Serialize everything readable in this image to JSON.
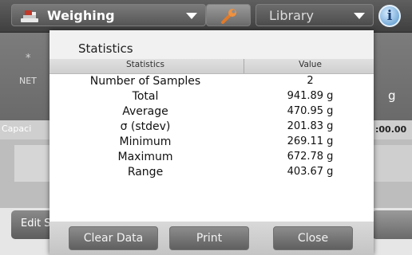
{
  "topbar": {
    "app_label": "Weighing",
    "library_label": "Library",
    "info_symbol": "i",
    "icons": {
      "app": "scale-icon",
      "tools": "wrench-icon",
      "info": "info-icon"
    }
  },
  "background": {
    "star": "*",
    "net_label": "NET",
    "unit": "g",
    "capacity_label": "Capaci",
    "capacity_value": ":00.00",
    "edit_label": "Edit S"
  },
  "dialog": {
    "title": "Statistics",
    "table": {
      "headers": {
        "statistic": "Statistics",
        "value": "Value"
      },
      "rows": [
        {
          "name": "Number of Samples",
          "value": "2"
        },
        {
          "name": "Total",
          "value": "941.89 g"
        },
        {
          "name": "Average",
          "value": "470.95 g"
        },
        {
          "name": "σ (stdev)",
          "value": "201.83 g"
        },
        {
          "name": "Minimum",
          "value": "269.11 g"
        },
        {
          "name": "Maximum",
          "value": "672.78 g"
        },
        {
          "name": "Range",
          "value": "403.67 g"
        }
      ]
    },
    "buttons": {
      "clear": "Clear Data",
      "print": "Print",
      "close": "Close"
    }
  },
  "colors": {
    "accent_info": "#4f90c8",
    "tool_orange": "#e07a2a",
    "app_red": "#c0392b"
  }
}
